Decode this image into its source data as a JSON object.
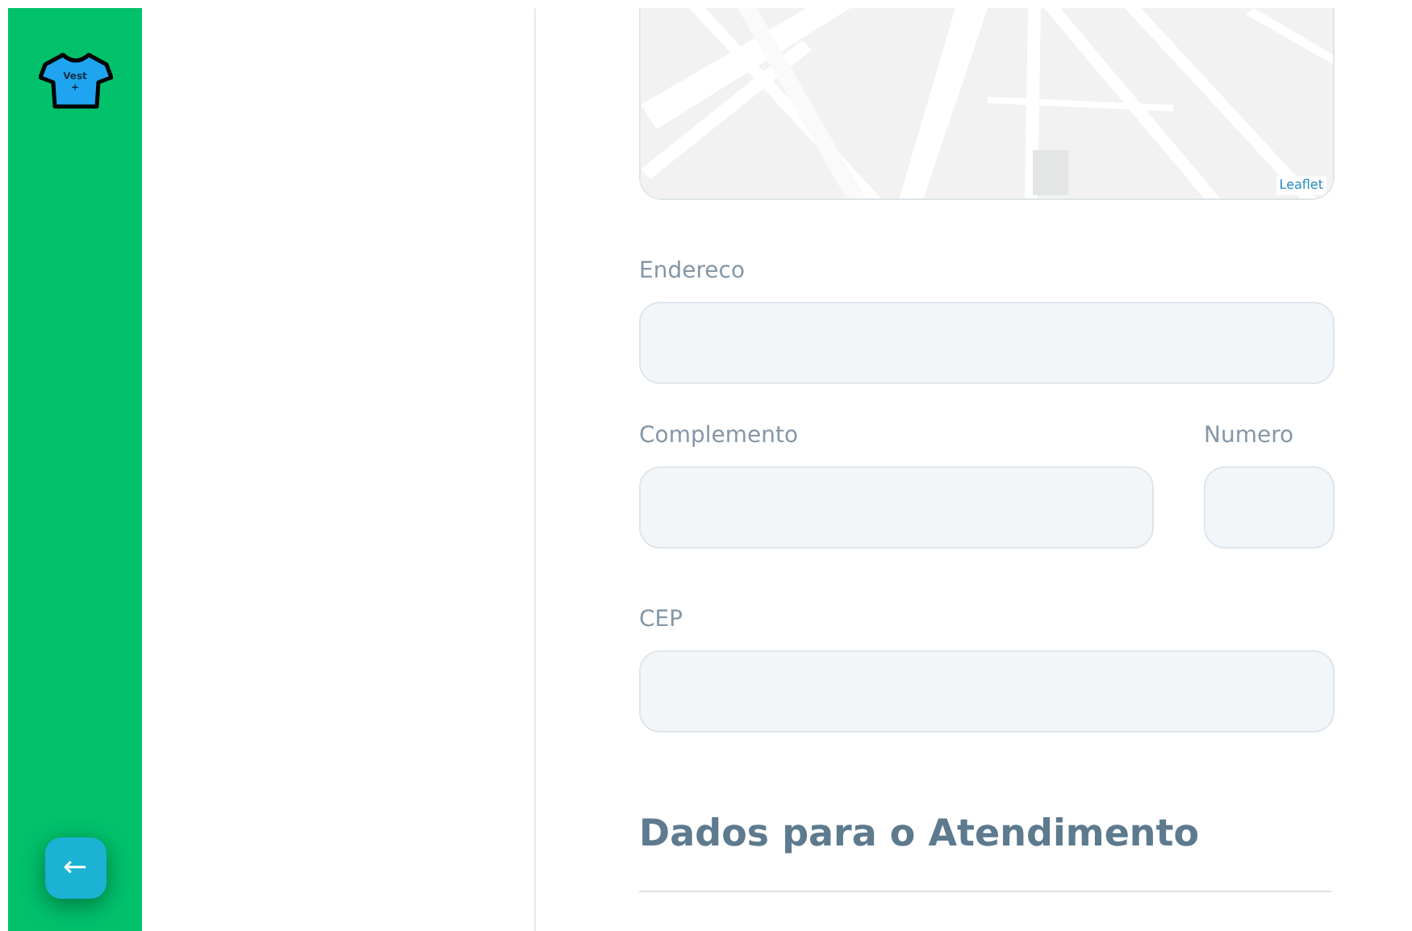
{
  "sidebar": {
    "logo": {
      "line_1": "Vest",
      "line_2": "+"
    },
    "back_button": {
      "symbol": "←"
    }
  },
  "map": {
    "kind": "picture",
    "attribution": "Leaflet"
  },
  "fields": [
    {
      "label": "Endereco",
      "kind": "full"
    },
    {
      "label": "Complemento",
      "kind": "wide"
    },
    {
      "label": "Numero",
      "kind": "narrow"
    },
    {
      "label": "CEP",
      "kind": "full"
    }
  ],
  "section_heading": "Dados para o Atendimento"
}
